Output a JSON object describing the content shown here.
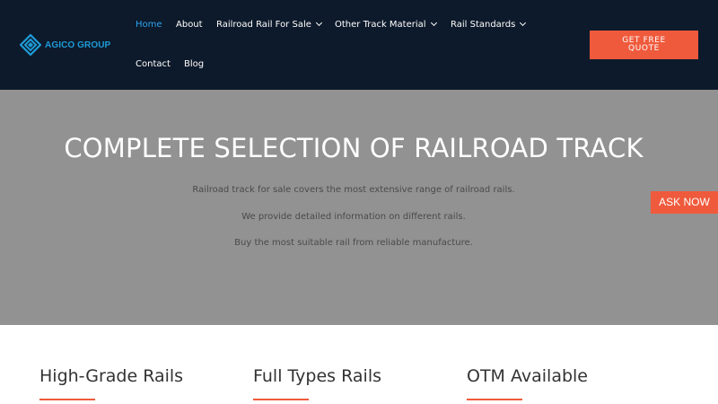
{
  "header": {
    "logo_text": "AGICO GROUP",
    "nav": [
      {
        "label": "Home",
        "active": true,
        "dropdown": false
      },
      {
        "label": "About",
        "active": false,
        "dropdown": false
      },
      {
        "label": "Railroad Rail For Sale",
        "active": false,
        "dropdown": true
      },
      {
        "label": "Other Track Material",
        "active": false,
        "dropdown": true
      },
      {
        "label": "Rail Standards",
        "active": false,
        "dropdown": true
      },
      {
        "label": "Contact",
        "active": false,
        "dropdown": false
      },
      {
        "label": "Blog",
        "active": false,
        "dropdown": false
      }
    ],
    "cta_line1": "GET FREE",
    "cta_line2": "QUOTE"
  },
  "hero": {
    "title": "COMPLETE SELECTION OF RAILROAD TRACK",
    "lines": [
      "Railroad track for sale covers the most extensive range of railroad rails.",
      "We provide detailed information on different rails.",
      "Buy the most suitable rail from reliable manufacture."
    ]
  },
  "ask_button": "ASK NOW",
  "features": [
    {
      "title": "High-Grade Rails"
    },
    {
      "title": "Full Types Rails"
    },
    {
      "title": "OTM Available"
    }
  ],
  "colors": {
    "header_bg": "#0d1a2b",
    "accent": "#ef5a3c",
    "active_link": "#2ea3f2",
    "logo": "#1e9bd7",
    "hero_bg": "#929292"
  }
}
